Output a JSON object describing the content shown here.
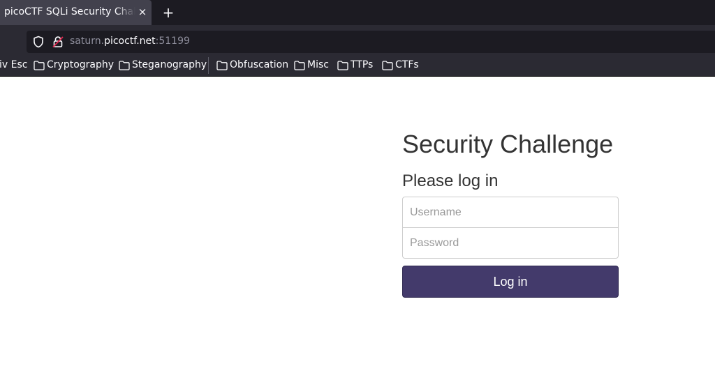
{
  "browser": {
    "tab_title": "picoCTF SQLi Security Challenge",
    "tab_close": "×",
    "new_tab": "+",
    "url": {
      "prefix": "saturn.",
      "host": "picoctf.net",
      "port": ":51199"
    },
    "bookmarks": [
      {
        "label": "iv Esc"
      },
      {
        "label": "Cryptography"
      },
      {
        "label": "Steganography"
      },
      {
        "label": "Obfuscation"
      },
      {
        "label": "Misc"
      },
      {
        "label": "TTPs"
      },
      {
        "label": "CTFs"
      }
    ]
  },
  "page": {
    "title": "Security Challenge",
    "subtitle": "Please log in",
    "username_placeholder": "Username",
    "password_placeholder": "Password",
    "login_label": "Log in"
  },
  "colors": {
    "tab_bg": "#1c1b22",
    "toolbar_bg": "#2b2a33",
    "button_bg": "#433a6b"
  },
  "icons": {
    "shield": "shield-icon",
    "lock": "insecure-lock-icon",
    "folder": "folder-icon"
  }
}
